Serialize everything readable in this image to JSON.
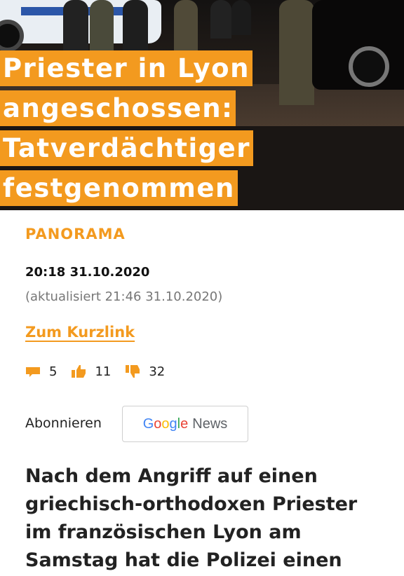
{
  "article": {
    "title_lines": [
      "Priester in Lyon",
      "angeschossen:",
      "Tatverdächtiger",
      "festgenommen"
    ],
    "category": "PANORAMA",
    "published": "20:18 31.10.2020",
    "updated": "(aktualisiert 21:46 31.10.2020)",
    "shortlink_label": "Zum Kurzlink",
    "lead": "Nach dem Angriff auf einen griechisch-orthodoxen Priester im französischen Lyon am Samstag hat die Polizei einen"
  },
  "stats": {
    "comments": "5",
    "likes": "11",
    "dislikes": "32",
    "icons": [
      "comment-icon",
      "thumbs-up-icon",
      "thumbs-down-icon"
    ]
  },
  "subscribe": {
    "label": "Abonnieren",
    "google_letters": [
      "G",
      "o",
      "o",
      "g",
      "l",
      "e"
    ],
    "google_colors": [
      "#4285F4",
      "#EA4335",
      "#FBBC05",
      "#4285F4",
      "#34A853",
      "#EA4335"
    ],
    "news_label": "News"
  },
  "colors": {
    "accent": "#f39a1f",
    "text": "#222222",
    "muted": "#777777"
  }
}
